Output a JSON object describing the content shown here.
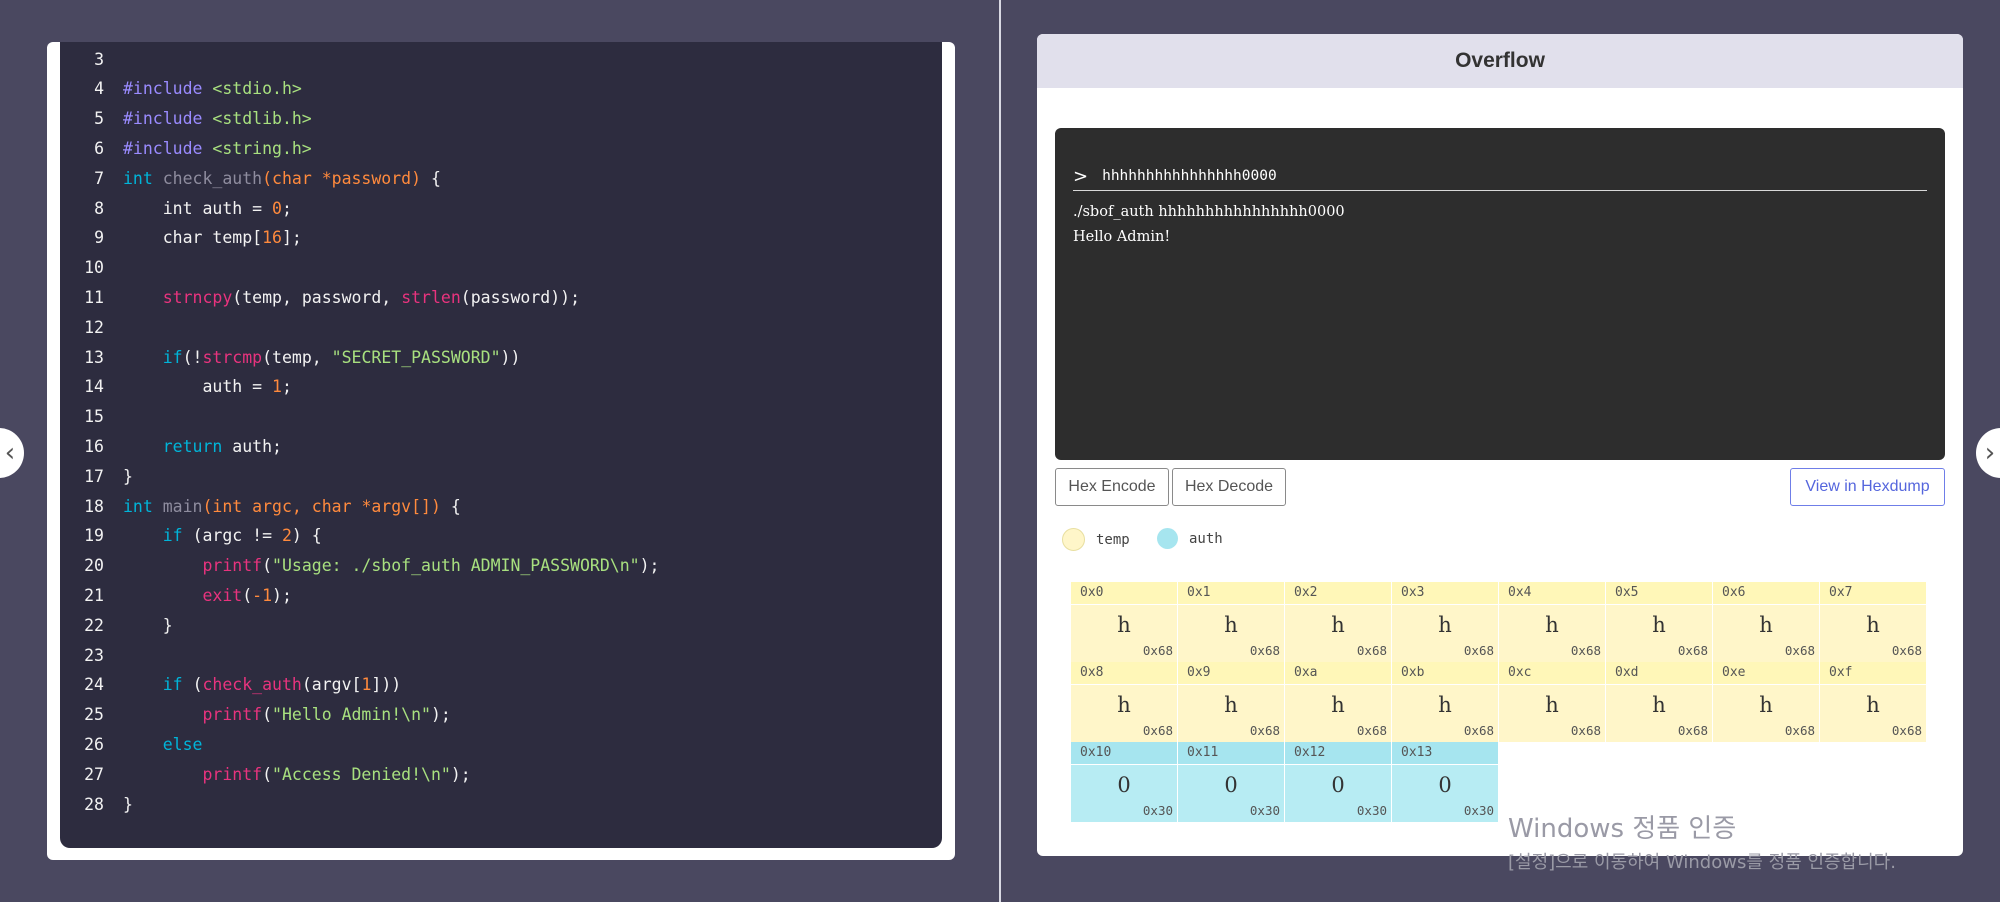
{
  "code": {
    "lines": [
      {
        "n": "3",
        "t": []
      },
      {
        "n": "4",
        "t": [
          [
            "pp",
            "#include "
          ],
          [
            "str",
            "<stdio.h>"
          ]
        ]
      },
      {
        "n": "5",
        "t": [
          [
            "pp",
            "#include "
          ],
          [
            "str",
            "<stdlib.h>"
          ]
        ]
      },
      {
        "n": "6",
        "t": [
          [
            "pp",
            "#include "
          ],
          [
            "str",
            "<string.h>"
          ]
        ]
      },
      {
        "n": "7",
        "t": [
          [
            "kw",
            "int "
          ],
          [
            "dim",
            "check_auth"
          ],
          [
            "org",
            "(char *password) "
          ],
          [
            "pl",
            "{"
          ]
        ]
      },
      {
        "n": "8",
        "t": [
          [
            "pl",
            "    int auth = "
          ],
          [
            "num",
            "0"
          ],
          [
            "pl",
            ";"
          ]
        ]
      },
      {
        "n": "9",
        "t": [
          [
            "pl",
            "    char temp["
          ],
          [
            "num",
            "16"
          ],
          [
            "pl",
            "];"
          ]
        ]
      },
      {
        "n": "10",
        "t": []
      },
      {
        "n": "11",
        "t": [
          [
            "pl",
            "    "
          ],
          [
            "fn",
            "strncpy"
          ],
          [
            "pl",
            "(temp, password, "
          ],
          [
            "fn",
            "strlen"
          ],
          [
            "pl",
            "(password));"
          ]
        ]
      },
      {
        "n": "12",
        "t": []
      },
      {
        "n": "13",
        "t": [
          [
            "pl",
            "    "
          ],
          [
            "kw",
            "if"
          ],
          [
            "pl",
            "(!"
          ],
          [
            "fn",
            "strcmp"
          ],
          [
            "pl",
            "(temp, "
          ],
          [
            "str",
            "\"SECRET_PASSWORD\""
          ],
          [
            "pl",
            "))"
          ]
        ]
      },
      {
        "n": "14",
        "t": [
          [
            "pl",
            "        auth = "
          ],
          [
            "num",
            "1"
          ],
          [
            "pl",
            ";"
          ]
        ]
      },
      {
        "n": "15",
        "t": []
      },
      {
        "n": "16",
        "t": [
          [
            "pl",
            "    "
          ],
          [
            "kw",
            "return "
          ],
          [
            "pl",
            "auth;"
          ]
        ]
      },
      {
        "n": "17",
        "t": [
          [
            "pl",
            "}"
          ]
        ]
      },
      {
        "n": "18",
        "t": [
          [
            "kw",
            "int "
          ],
          [
            "dim",
            "main"
          ],
          [
            "org",
            "(int argc, char *argv[]) "
          ],
          [
            "pl",
            "{"
          ]
        ]
      },
      {
        "n": "19",
        "t": [
          [
            "pl",
            "    "
          ],
          [
            "kw",
            "if "
          ],
          [
            "pl",
            "(argc != "
          ],
          [
            "num",
            "2"
          ],
          [
            "pl",
            ") {"
          ]
        ]
      },
      {
        "n": "20",
        "t": [
          [
            "pl",
            "        "
          ],
          [
            "fn",
            "printf"
          ],
          [
            "pl",
            "("
          ],
          [
            "str",
            "\"Usage: ./sbof_auth ADMIN_PASSWORD\\n\""
          ],
          [
            "pl",
            ");"
          ]
        ]
      },
      {
        "n": "21",
        "t": [
          [
            "pl",
            "        "
          ],
          [
            "fn",
            "exit"
          ],
          [
            "pl",
            "("
          ],
          [
            "num",
            "-1"
          ],
          [
            "pl",
            ");"
          ]
        ]
      },
      {
        "n": "22",
        "t": [
          [
            "pl",
            "    }"
          ]
        ]
      },
      {
        "n": "23",
        "t": []
      },
      {
        "n": "24",
        "t": [
          [
            "pl",
            "    "
          ],
          [
            "kw",
            "if "
          ],
          [
            "pl",
            "("
          ],
          [
            "fn",
            "check_auth"
          ],
          [
            "pl",
            "(argv["
          ],
          [
            "num",
            "1"
          ],
          [
            "pl",
            "]))"
          ]
        ]
      },
      {
        "n": "25",
        "t": [
          [
            "pl",
            "        "
          ],
          [
            "fn",
            "printf"
          ],
          [
            "pl",
            "("
          ],
          [
            "str",
            "\"Hello Admin!\\n\""
          ],
          [
            "pl",
            ");"
          ]
        ]
      },
      {
        "n": "26",
        "t": [
          [
            "pl",
            "    "
          ],
          [
            "kw",
            "else"
          ]
        ]
      },
      {
        "n": "27",
        "t": [
          [
            "pl",
            "        "
          ],
          [
            "fn",
            "printf"
          ],
          [
            "pl",
            "("
          ],
          [
            "str",
            "\"Access Denied!\\n\""
          ],
          [
            "pl",
            ");"
          ]
        ]
      },
      {
        "n": "28",
        "t": [
          [
            "pl",
            "}"
          ]
        ]
      }
    ]
  },
  "overflow": {
    "title": "Overflow",
    "terminal": {
      "prompt": ">",
      "input_value": "hhhhhhhhhhhhhhhh0000",
      "output_lines": [
        "./sbof_auth hhhhhhhhhhhhhhhh0000",
        "Hello Admin!"
      ]
    },
    "buttons": {
      "hex_encode": "Hex Encode",
      "hex_decode": "Hex Decode",
      "view_hexdump": "View in Hexdump"
    },
    "legend": [
      {
        "label": "temp",
        "color": "#fff6c9"
      },
      {
        "label": "auth",
        "color": "#a6e5ef"
      }
    ],
    "memory": [
      {
        "addr": "0x0",
        "ch": "h",
        "hex": "0x68",
        "var": "temp"
      },
      {
        "addr": "0x1",
        "ch": "h",
        "hex": "0x68",
        "var": "temp"
      },
      {
        "addr": "0x2",
        "ch": "h",
        "hex": "0x68",
        "var": "temp"
      },
      {
        "addr": "0x3",
        "ch": "h",
        "hex": "0x68",
        "var": "temp"
      },
      {
        "addr": "0x4",
        "ch": "h",
        "hex": "0x68",
        "var": "temp"
      },
      {
        "addr": "0x5",
        "ch": "h",
        "hex": "0x68",
        "var": "temp"
      },
      {
        "addr": "0x6",
        "ch": "h",
        "hex": "0x68",
        "var": "temp"
      },
      {
        "addr": "0x7",
        "ch": "h",
        "hex": "0x68",
        "var": "temp"
      },
      {
        "addr": "0x8",
        "ch": "h",
        "hex": "0x68",
        "var": "temp"
      },
      {
        "addr": "0x9",
        "ch": "h",
        "hex": "0x68",
        "var": "temp"
      },
      {
        "addr": "0xa",
        "ch": "h",
        "hex": "0x68",
        "var": "temp"
      },
      {
        "addr": "0xb",
        "ch": "h",
        "hex": "0x68",
        "var": "temp"
      },
      {
        "addr": "0xc",
        "ch": "h",
        "hex": "0x68",
        "var": "temp"
      },
      {
        "addr": "0xd",
        "ch": "h",
        "hex": "0x68",
        "var": "temp"
      },
      {
        "addr": "0xe",
        "ch": "h",
        "hex": "0x68",
        "var": "temp"
      },
      {
        "addr": "0xf",
        "ch": "h",
        "hex": "0x68",
        "var": "temp"
      },
      {
        "addr": "0x10",
        "ch": "0",
        "hex": "0x30",
        "var": "auth"
      },
      {
        "addr": "0x11",
        "ch": "0",
        "hex": "0x30",
        "var": "auth"
      },
      {
        "addr": "0x12",
        "ch": "0",
        "hex": "0x30",
        "var": "auth"
      },
      {
        "addr": "0x13",
        "ch": "0",
        "hex": "0x30",
        "var": "auth"
      }
    ]
  },
  "watermark": {
    "line1": "Windows 정품 인증",
    "line2": "[설정]으로 이동하여 Windows를 정품 인증합니다."
  },
  "nav": {
    "prev_icon": "chevron-left-icon",
    "next_icon": "chevron-right-icon"
  }
}
